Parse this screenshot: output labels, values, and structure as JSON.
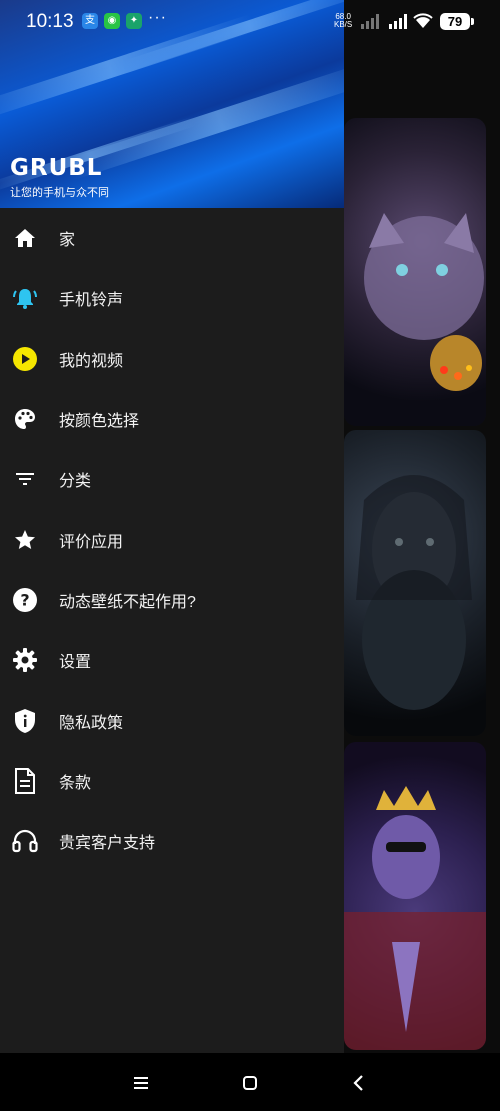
{
  "status_bar": {
    "time": "10:13",
    "more": "···",
    "net_speed_value": "68.0",
    "net_speed_unit": "KB/S",
    "battery": "79"
  },
  "drawer": {
    "brand": "GRUBL",
    "tagline": "让您的手机与众不同",
    "items": [
      {
        "label": "家",
        "icon": "home-icon"
      },
      {
        "label": "手机铃声",
        "icon": "bell-ringing-icon"
      },
      {
        "label": "我的视频",
        "icon": "play-circle-icon"
      },
      {
        "label": "按颜色选择",
        "icon": "palette-icon"
      },
      {
        "label": "分类",
        "icon": "filter-list-icon"
      },
      {
        "label": "评价应用",
        "icon": "star-icon"
      },
      {
        "label": "动态壁纸不起作用?",
        "icon": "help-circle-icon"
      },
      {
        "label": "设置",
        "icon": "gear-icon"
      },
      {
        "label": "隐私政策",
        "icon": "shield-info-icon"
      },
      {
        "label": "条款",
        "icon": "document-icon"
      },
      {
        "label": "贵宾客户支持",
        "icon": "headset-icon"
      }
    ]
  },
  "colors": {
    "drawer_bg": "#1c1c1c",
    "bell_accent": "#2ec4f0",
    "play_accent": "#f5e600",
    "header_blue": "#0a5bd6"
  },
  "nav": {
    "menu": "menu-icon",
    "home": "home-square-icon",
    "back": "back-icon"
  }
}
